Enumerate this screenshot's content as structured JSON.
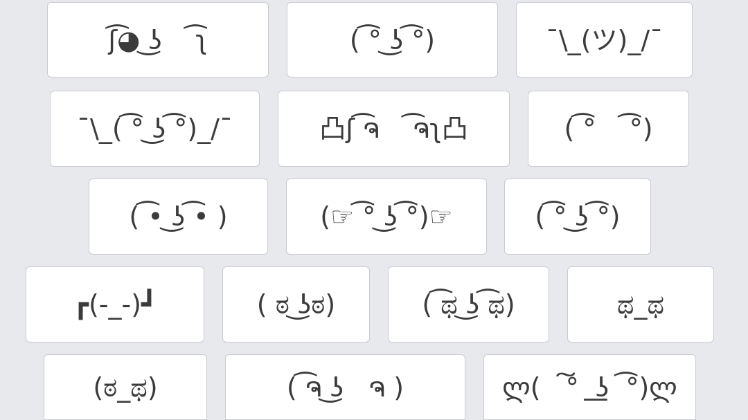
{
  "rows": [
    [
      {
        "text": "ʃ͡◕ ͜ʖ    ͡ʅ"
      },
      {
        "text": "( ͡° ͜ʖ ͡°)"
      },
      {
        "text": "¯\\_(ツ)_/¯"
      }
    ],
    [
      {
        "text": "¯\\_( ͡° ͜ʖ ͡°)_/¯"
      },
      {
        "text": "凸ʃ ͡ຈ    ͡ຈʅ凸"
      },
      {
        "text": "( ͡°    ͡°)"
      }
    ],
    [
      {
        "text": "( ͡• ͜ʖ ͡• )"
      },
      {
        "text": "(☞ ͡° ͜ʖ ͡°)☞"
      },
      {
        "text": "( ͡° ͜ʖ ͡°)"
      }
    ],
    [
      {
        "text": "┏(-_-)┛"
      },
      {
        "text": "( ಠ ͜ʖಠ)"
      },
      {
        "text": "( ͡ಥ ͜ʖ ͡ಥ)"
      },
      {
        "text": "ಥ_ಥ"
      }
    ],
    [
      {
        "text": "(ಠ_ಥ)"
      },
      {
        "text": "( ͡ຈ ͜ʖ   ຈ )"
      },
      {
        "text": "ლ(   ͠°  ͟ʖ  ͡°)ლ"
      }
    ]
  ]
}
